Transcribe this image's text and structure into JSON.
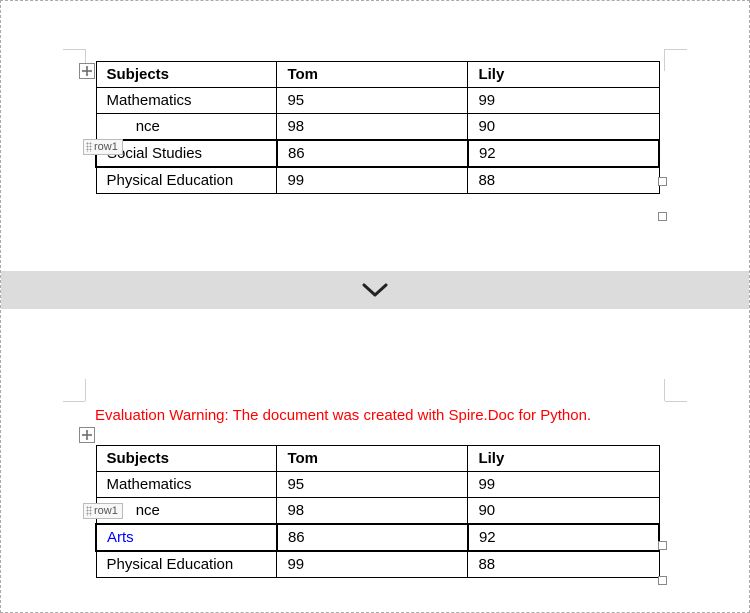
{
  "divider_icon": "chevron-down",
  "top_page": {
    "anchor_icon": "move",
    "row_tag": "row1",
    "table": {
      "headers": [
        "Subjects",
        "Tom",
        "Lily"
      ],
      "rows": [
        {
          "subject": "Mathematics",
          "tom": "95",
          "lily": "99"
        },
        {
          "subject_visible": "nce",
          "tom": "98",
          "lily": "90"
        },
        {
          "subject": "Social Studies",
          "tom": "86",
          "lily": "92"
        },
        {
          "subject": "Physical Education",
          "tom": "99",
          "lily": "88"
        }
      ]
    }
  },
  "bottom_page": {
    "warning": "Evaluation Warning: The document was created with Spire.Doc for Python.",
    "anchor_icon": "move",
    "row_tag": "row1",
    "table": {
      "headers": [
        "Subjects",
        "Tom",
        "Lily"
      ],
      "rows": [
        {
          "subject": "Mathematics",
          "tom": "95",
          "lily": "99"
        },
        {
          "subject_visible": "nce",
          "tom": "98",
          "lily": "90"
        },
        {
          "subject": "Arts",
          "tom": "86",
          "lily": "92"
        },
        {
          "subject": "Physical Education",
          "tom": "99",
          "lily": "88"
        }
      ]
    }
  }
}
